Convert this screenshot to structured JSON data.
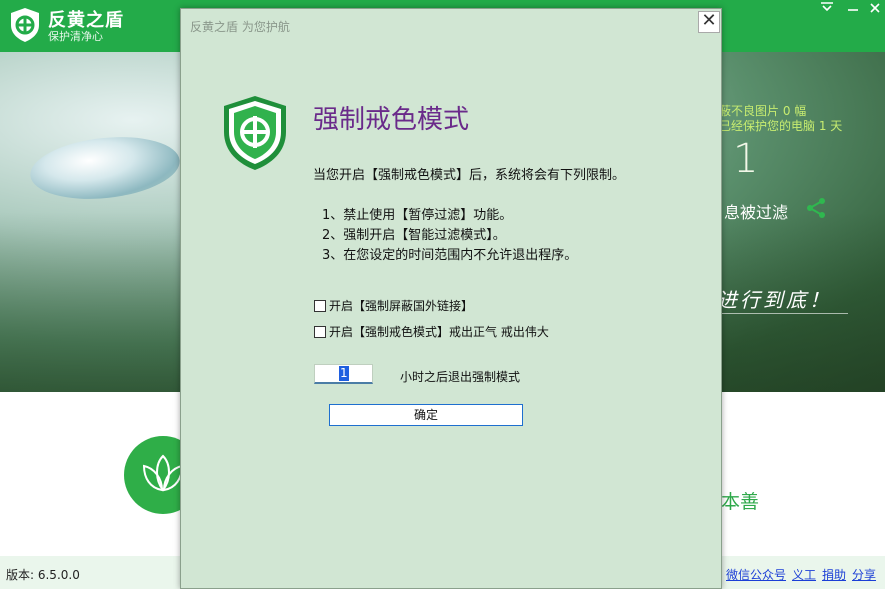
{
  "app": {
    "name": "反黄之盾",
    "slogan": "保护清净心",
    "menu_icon": "menu-icon",
    "minimize_icon": "minimize-icon",
    "close_icon": "close-icon"
  },
  "stats": {
    "blocked_images": "蔽不良图片 0 幅",
    "protected_days": "已经保护您的电脑 1 天",
    "big_count": "1",
    "filtered_label": "息被过滤",
    "motto": "进行到底！"
  },
  "bottom": {
    "goodness": "本善"
  },
  "footer": {
    "version": "版本: 6.5.0.0",
    "links": [
      "微信公众号",
      "义工",
      "捐助",
      "分享"
    ]
  },
  "dialog": {
    "title": "反黄之盾 为您护航",
    "close_label": "✕",
    "heading": "强制戒色模式",
    "intro": "当您开启【强制戒色模式】后，系统将会有下列限制。",
    "rules": [
      "1、禁止使用【暂停过滤】功能。",
      "2、强制开启【智能过滤模式】。",
      "3、在您设定的时间范围内不允许退出程序。"
    ],
    "options": [
      {
        "label": "开启【强制屏蔽国外链接】",
        "checked": false
      },
      {
        "label": "开启【强制戒色模式】戒出正气 戒出伟大",
        "checked": false
      }
    ],
    "hours_value": "1",
    "hours_label": "小时之后退出强制模式",
    "confirm_label": "确定"
  },
  "colors": {
    "brand_green": "#23ab49",
    "dialog_bg": "#d1e6d3",
    "heading_purple": "#6a2a8a",
    "link_blue": "#1c3fd6"
  }
}
